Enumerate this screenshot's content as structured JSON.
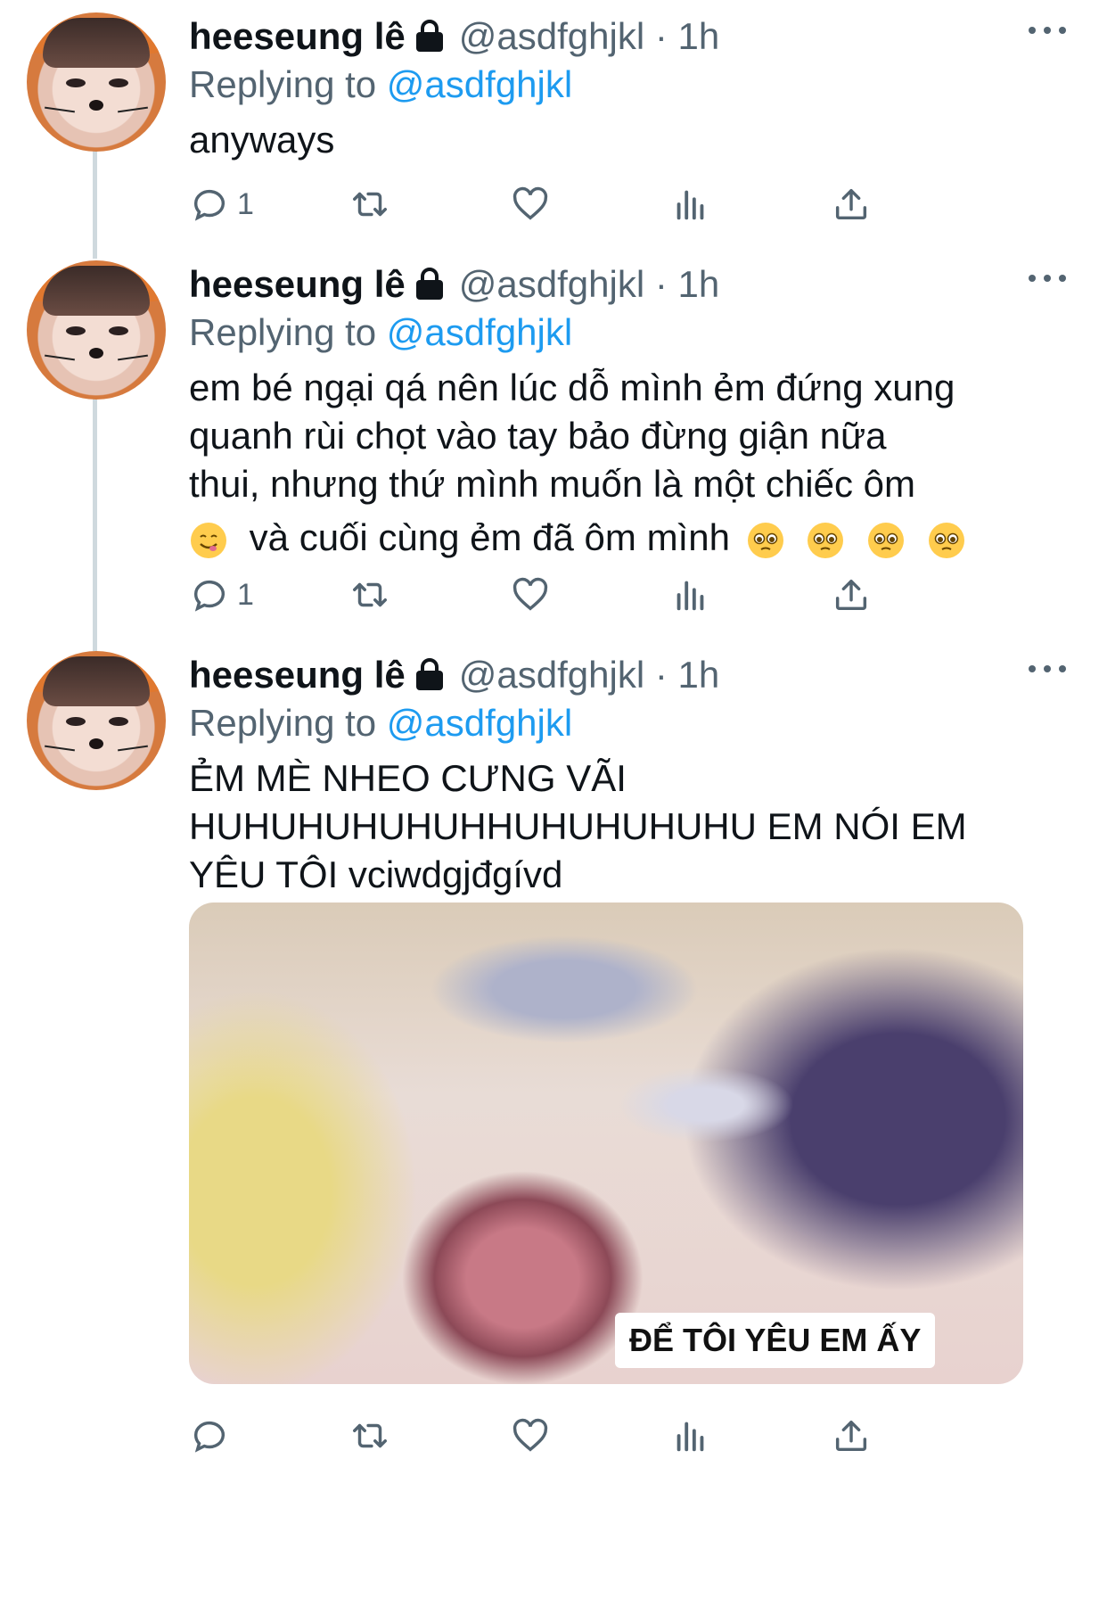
{
  "tweets": [
    {
      "name": "heeseung lê",
      "handle": "@asdfghjkl · 1h",
      "reply_prefix": "Replying to",
      "reply_to": "@asdfghjkl",
      "text_lines": [
        "anyways"
      ],
      "reply_count": "1"
    },
    {
      "name": "heeseung lê",
      "handle": "@asdfghjkl · 1h",
      "reply_prefix": "Replying to",
      "reply_to": "@asdfghjkl",
      "text_lines": [
        "em bé ngại qá nên lúc dỗ mình ẻm đứng xung",
        "quanh rùi chọt vào tay bảo đừng giận nữa",
        "thui, nhưng thứ mình muốn là một chiếc ôm"
      ],
      "text_last_line": "và cuối cùng ẻm đã ôm mình",
      "emojis": [
        "yum-emoji",
        "pleading-emoji",
        "pleading-emoji",
        "pleading-emoji",
        "pleading-emoji"
      ],
      "reply_count": "1"
    },
    {
      "name": "heeseung lê",
      "handle": "@asdfghjkl · 1h",
      "reply_prefix": "Replying to",
      "reply_to": "@asdfghjkl",
      "text_lines": [
        "ẺM MÈ NHEO CƯNG VÃI",
        "HUHUHUHUHUHHUHUHUHUHU EM NÓI EM",
        "YÊU TÔI vciwdgjđgívd"
      ],
      "media_caption": "ĐỂ TÔI YÊU EM ẤY",
      "reply_count": ""
    }
  ],
  "colors": {
    "text": "#0f1419",
    "secondary": "#536471",
    "link": "#1d9bf0",
    "thread": "#cfd9de"
  }
}
